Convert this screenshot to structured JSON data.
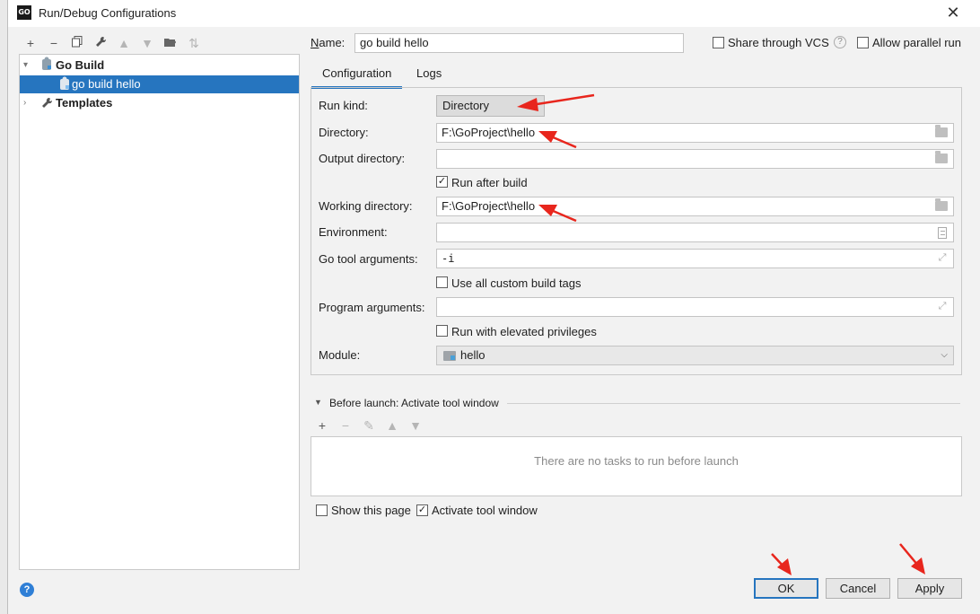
{
  "window": {
    "title": "Run/Debug Configurations",
    "app_icon_text": "GO"
  },
  "toolbar": {
    "add": "+",
    "remove": "−",
    "copy": "⧉",
    "edit": "🔧",
    "up": "▲",
    "down": "▼",
    "folder": "📁",
    "sort": "⇅"
  },
  "tree": {
    "group_label": "Go Build",
    "item_label": "go build hello",
    "templates_label": "Templates"
  },
  "header": {
    "name_label": "Name:",
    "name_value": "go build hello",
    "share_vcs_label": "Share through VCS",
    "share_vcs_checked": false,
    "help_icon": "?",
    "allow_parallel_label": "Allow parallel run",
    "allow_parallel_checked": false
  },
  "tabs": [
    {
      "label": "Configuration",
      "active": true
    },
    {
      "label": "Logs",
      "active": false
    }
  ],
  "config": {
    "run_kind_label": "Run kind:",
    "run_kind_value": "Directory",
    "directory_label": "Directory:",
    "directory_value": "F:\\GoProject\\hello",
    "output_directory_label": "Output directory:",
    "output_directory_value": "",
    "run_after_build_label": "Run after build",
    "run_after_build_checked": true,
    "working_directory_label": "Working directory:",
    "working_directory_value": "F:\\GoProject\\hello",
    "environment_label": "Environment:",
    "environment_value": "",
    "go_tool_args_label": "Go tool arguments:",
    "go_tool_args_value": "-i",
    "custom_build_tags_label": "Use all custom build tags",
    "custom_build_tags_checked": false,
    "program_args_label": "Program arguments:",
    "program_args_value": "",
    "elevated_label": "Run with elevated privileges",
    "elevated_checked": false,
    "module_label": "Module:",
    "module_value": "hello"
  },
  "before_launch": {
    "title": "Before launch: Activate tool window",
    "empty_text": "There are no tasks to run before launch"
  },
  "footer": {
    "show_page_label": "Show this page",
    "show_page_checked": false,
    "activate_tool_window_label": "Activate tool window",
    "activate_tool_window_checked": true,
    "help_icon": "?",
    "ok_label": "OK",
    "cancel_label": "Cancel",
    "apply_label": "Apply"
  },
  "colors": {
    "accent": "#2675bf",
    "annotation_arrow": "#e8261d"
  }
}
